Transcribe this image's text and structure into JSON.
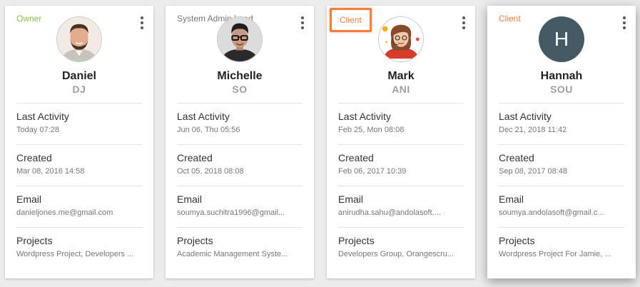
{
  "field_labels": {
    "last_activity": "Last Activity",
    "created": "Created",
    "email": "Email",
    "projects": "Projects"
  },
  "users": [
    {
      "role": "Owner",
      "name": "Daniel",
      "short": "DJ",
      "avatar": "man-with-beard-photo",
      "last_activity": "Today 07:28",
      "created": "Mar 08, 2016 14:58",
      "email": "danieljones.me@gmail.com",
      "projects": "Wordpress Project, Developers ..."
    },
    {
      "role": "System Admin,Lead",
      "name": "Michelle",
      "short": "SO",
      "avatar": "man-with-glasses-photo",
      "last_activity": "Jun 06, Thu 05:56",
      "created": "Oct 05, 2018 08:08",
      "email": "soumya.suchitra1996@gmail...",
      "projects": "Academic Management Syste..."
    },
    {
      "role": "Client",
      "name": "Mark",
      "short": "ANI",
      "avatar": "woman-with-headset-illustration",
      "last_activity": "Feb 25, Mon 08:08",
      "created": "Feb 06, 2017 10:39",
      "email": "anirudha.sahu@andolasoft....",
      "projects": "Developers Group, Orangescru..."
    },
    {
      "role": "Client",
      "name": "Hannah",
      "short": "SOU",
      "avatar_initial": "H",
      "last_activity": "Dec 21, 2018 11:42",
      "created": "Sep 08, 2017 08:48",
      "email": "soumya.andolasoft@gmail.c...",
      "projects": "Wordpress Project For Jamie, ..."
    }
  ],
  "colors": {
    "owner_role": "#8bc34a",
    "admin_role": "#757575",
    "client_role": "#f47d3b",
    "highlight_border": "#f47d3b",
    "initial_avatar_bg": "#455a64"
  }
}
